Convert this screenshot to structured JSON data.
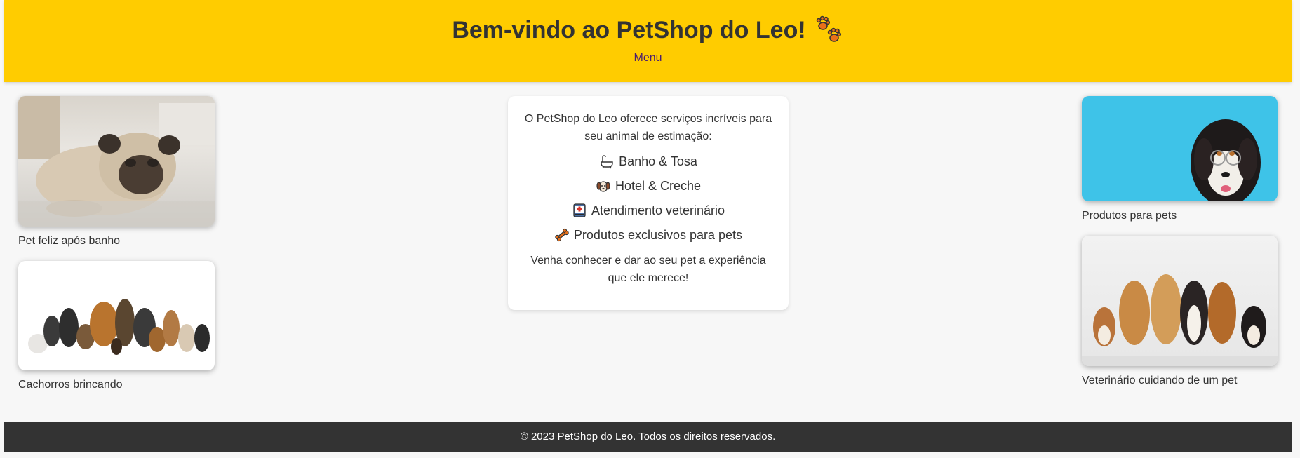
{
  "header": {
    "title": "Bem-vindo ao PetShop do Leo!",
    "menu_label": "Menu"
  },
  "gallery": {
    "left": [
      {
        "caption": "Pet feliz após banho"
      },
      {
        "caption": "Cachorros brincando"
      }
    ],
    "right": [
      {
        "caption": "Produtos para pets"
      },
      {
        "caption": "Veterinário cuidando de um pet"
      }
    ]
  },
  "info": {
    "intro": "O PetShop do Leo oferece serviços incríveis para seu animal de estimação:",
    "services": [
      {
        "icon": "bathtub-icon",
        "label": "Banho & Tosa"
      },
      {
        "icon": "dog-face-icon",
        "label": "Hotel & Creche"
      },
      {
        "icon": "medical-kit-icon",
        "label": "Atendimento veterinário"
      },
      {
        "icon": "bone-icon",
        "label": "Produtos exclusivos para pets"
      }
    ],
    "closing": "Venha conhecer e dar ao seu pet a experiência que ele merece!"
  },
  "footer": {
    "text": "© 2023 PetShop do Leo. Todos os direitos reservados."
  },
  "colors": {
    "header_bg": "#ffcc00",
    "footer_bg": "#333333",
    "page_bg": "#f7f7f7",
    "link": "#4b1e6e"
  }
}
